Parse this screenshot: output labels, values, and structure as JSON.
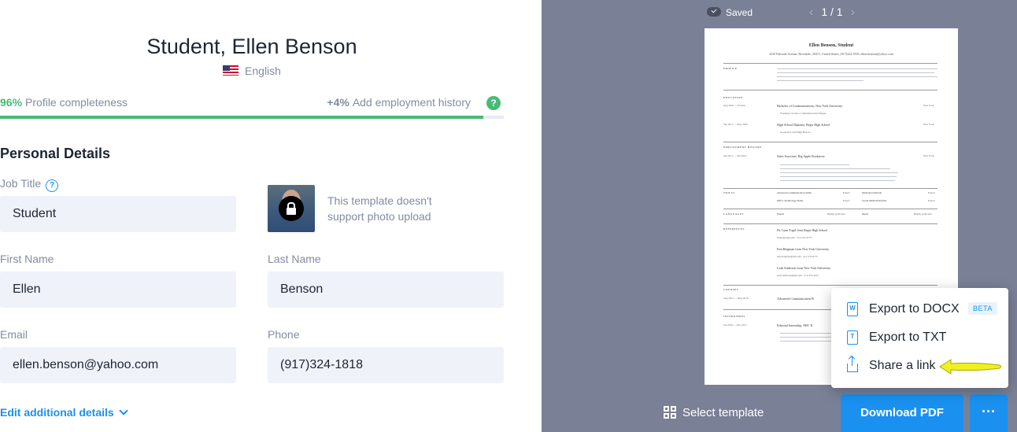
{
  "editor": {
    "resume_name": "Student, Ellen Benson",
    "language": "English",
    "completeness": {
      "percent_label": "96%",
      "label": "Profile completeness",
      "value": 0.96
    },
    "hint": {
      "plus": "+4%",
      "label": "Add employment history",
      "help": "?"
    },
    "section_title": "Personal Details",
    "job_title": {
      "label": "Job Title",
      "value": "Student",
      "help": "?"
    },
    "photo_note": "This template doesn't support photo upload",
    "first_name": {
      "label": "First Name",
      "value": "Ellen"
    },
    "last_name": {
      "label": "Last Name",
      "value": "Benson"
    },
    "email": {
      "label": "Email",
      "value": "ellen.benson@yahoo.com"
    },
    "phone": {
      "label": "Phone",
      "value": "(917)324-1818"
    },
    "edit_more": "Edit additional details"
  },
  "preview": {
    "saved": "Saved",
    "pager": "1 / 1",
    "select_template": "Select template",
    "download": "Download PDF",
    "more": "···",
    "page": {
      "name": "Ellen  Benson, Student",
      "contact": "4230 Palisade Avenue, Riverdale, 20471, United States, (917)324-1818, ellen.benson@yahoo.com",
      "sections": {
        "profile": "PROFILE",
        "education": "EDUCATION",
        "employment": "EMPLOYMENT HISTORY",
        "skills": "SKILLS",
        "languages": "LANGUAGES",
        "references": "REFERENCES",
        "courses": "COURSES",
        "internships": "INTERNSHIPS"
      },
      "edu1": {
        "date": "Aug 2016 — Present",
        "title": "Bachelor of Communications, New York University",
        "city": "New York",
        "bullet": "Working towards a Communications Degree."
      },
      "edu2": {
        "date": "Sep 2012 — May 2016",
        "title": "High School Diploma, Regis High School",
        "city": "New York",
        "bullet": "Graduated with High Honors."
      },
      "job1": {
        "date": "Sep 2015 — Jun 2016",
        "title": "Sales Associate, Big Apple Bookstore",
        "city": "New York"
      },
      "skills": [
        "Advanced Communication Skills",
        "Expert",
        "Motivated Attitude",
        "Expert",
        "Office Technology Skills",
        "Expert",
        "Social Media Platforms",
        "Expert"
      ],
      "languages": [
        "French",
        "Highly proficient",
        "Dutch",
        "Highly proficient"
      ],
      "refs": [
        {
          "name": "Dr. Lynn Fogel from Regis High School",
          "contact": "lfogel@regis.edu · 212-555-4775"
        },
        {
          "name": "Ken Bergman from New York University",
          "contact": "ken.bergman@nyu.edu · 212-555-9772"
        },
        {
          "name": "Leah Anderson from New York University",
          "contact": "leah.anderson@nyu.edu · 212-555-4521"
        }
      ],
      "course": {
        "date": "Aug 2015 — May 2016",
        "title": "Advanced Communication Pr"
      },
      "intern": {
        "date": "Jun 2016 — Dec 2017",
        "title": "Editorial Internship, NBC N"
      }
    }
  },
  "menu": {
    "docx": "Export to DOCX",
    "docx_icon": "W",
    "beta": "BETA",
    "txt": "Export to TXT",
    "txt_icon": "T",
    "share": "Share a link"
  },
  "colors": {
    "accent": "#1a91f0",
    "success": "#48ba75",
    "preview_bg": "#7a8196",
    "arrow": "#f0f020"
  }
}
